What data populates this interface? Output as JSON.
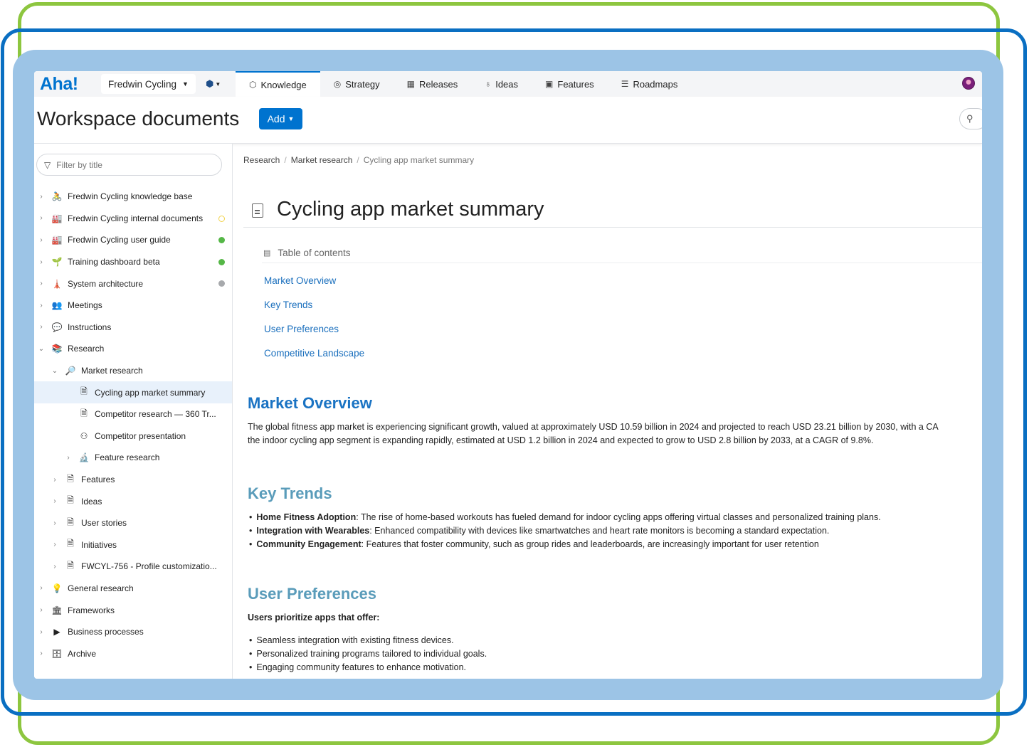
{
  "app": {
    "logo": "Aha!",
    "workspace": "Fredwin Cycling",
    "tabs": [
      {
        "icon": "⬡",
        "label": "Knowledge"
      },
      {
        "icon": "◎",
        "label": "Strategy"
      },
      {
        "icon": "▦",
        "label": "Releases"
      },
      {
        "icon": "♁",
        "label": "Ideas"
      },
      {
        "icon": "▣",
        "label": "Features"
      },
      {
        "icon": "☰",
        "label": "Roadmaps"
      }
    ],
    "accent_color": "#0073cf"
  },
  "header": {
    "title": "Workspace documents",
    "add_label": "Add"
  },
  "sidebar": {
    "filter_placeholder": "Filter by title",
    "items": [
      {
        "label": "Fredwin Cycling knowledge base",
        "icon": "🚴",
        "depth": 0,
        "chevron": "›",
        "status": ""
      },
      {
        "label": "Fredwin Cycling internal documents",
        "icon": "🏭",
        "depth": 0,
        "chevron": "›",
        "status": "ring"
      },
      {
        "label": "Fredwin Cycling user guide",
        "icon": "🏭",
        "depth": 0,
        "chevron": "›",
        "status": "green"
      },
      {
        "label": "Training dashboard beta",
        "icon": "🌱",
        "depth": 0,
        "chevron": "›",
        "status": "green"
      },
      {
        "label": "System architecture",
        "icon": "🗼",
        "depth": 0,
        "chevron": "›",
        "status": "gray"
      },
      {
        "label": "Meetings",
        "icon": "👥",
        "depth": 0,
        "chevron": "›",
        "status": ""
      },
      {
        "label": "Instructions",
        "icon": "💬",
        "depth": 0,
        "chevron": "›",
        "status": ""
      },
      {
        "label": "Research",
        "icon": "📚",
        "depth": 0,
        "chevron": "⌄",
        "status": ""
      },
      {
        "label": "Market research",
        "icon": "🔎",
        "depth": 1,
        "chevron": "⌄",
        "status": ""
      },
      {
        "label": "Cycling app market summary",
        "icon": "🗎",
        "depth": 2,
        "chevron": "",
        "status": "",
        "selected": true
      },
      {
        "label": "Competitor research — 360 Tr...",
        "icon": "🗎",
        "depth": 2,
        "chevron": "",
        "status": ""
      },
      {
        "label": "Competitor presentation",
        "icon": "⚇",
        "depth": 2,
        "chevron": "",
        "status": ""
      },
      {
        "label": "Feature research",
        "icon": "🔬",
        "depth": 2,
        "chevron": "›",
        "status": ""
      },
      {
        "label": "Features",
        "icon": "🗎",
        "depth": 1,
        "chevron": "›",
        "status": ""
      },
      {
        "label": "Ideas",
        "icon": "🗎",
        "depth": 1,
        "chevron": "›",
        "status": ""
      },
      {
        "label": "User stories",
        "icon": "🗎",
        "depth": 1,
        "chevron": "›",
        "status": ""
      },
      {
        "label": "Initiatives",
        "icon": "🗎",
        "depth": 1,
        "chevron": "›",
        "status": ""
      },
      {
        "label": "FWCYL-756 - Profile customizatio...",
        "icon": "🗎",
        "depth": 1,
        "chevron": "›",
        "status": ""
      },
      {
        "label": "General research",
        "icon": "💡",
        "depth": 0,
        "chevron": "›",
        "status": ""
      },
      {
        "label": "Frameworks",
        "icon": "🏛",
        "depth": 0,
        "chevron": "›",
        "status": ""
      },
      {
        "label": "Business processes",
        "icon": "▶",
        "depth": 0,
        "chevron": "›",
        "status": ""
      },
      {
        "label": "Archive",
        "icon": "🗄",
        "depth": 0,
        "chevron": "›",
        "status": ""
      }
    ]
  },
  "breadcrumb": [
    "Research",
    "Market research",
    "Cycling app market summary"
  ],
  "document": {
    "title": "Cycling app market summary",
    "toc_heading": "Table of contents",
    "toc": [
      "Market Overview",
      "Key Trends",
      "User Preferences",
      "Competitive Landscape"
    ],
    "market_overview": {
      "heading": "Market Overview",
      "line1": "The global fitness app market is experiencing significant growth, valued at approximately USD 10.59 billion in 2024 and projected to reach USD 23.21 billion by 2030, with a CA",
      "line2": "the indoor cycling app segment is expanding rapidly, estimated at USD 1.2 billion in 2024 and expected to grow to USD 2.8 billion by 2033, at a CAGR of 9.8%."
    },
    "key_trends": {
      "heading": "Key Trends",
      "items": [
        {
          "term": "Home Fitness Adoption",
          "text": ": The rise of home-based workouts has fueled demand for indoor cycling apps offering virtual classes and personalized training plans."
        },
        {
          "term": "Integration with Wearables",
          "text": ": Enhanced compatibility with devices like smartwatches and heart rate monitors is becoming a standard expectation."
        },
        {
          "term": "Community Engagement",
          "text": ": Features that foster community, such as group rides and leaderboards, are increasingly important for user retention"
        }
      ]
    },
    "user_preferences": {
      "heading": "User Preferences",
      "lead": "Users prioritize apps that offer:",
      "items": [
        "Seamless integration with existing fitness devices.",
        "Personalized training programs tailored to individual goals.",
        "Engaging community features to enhance motivation."
      ]
    }
  }
}
